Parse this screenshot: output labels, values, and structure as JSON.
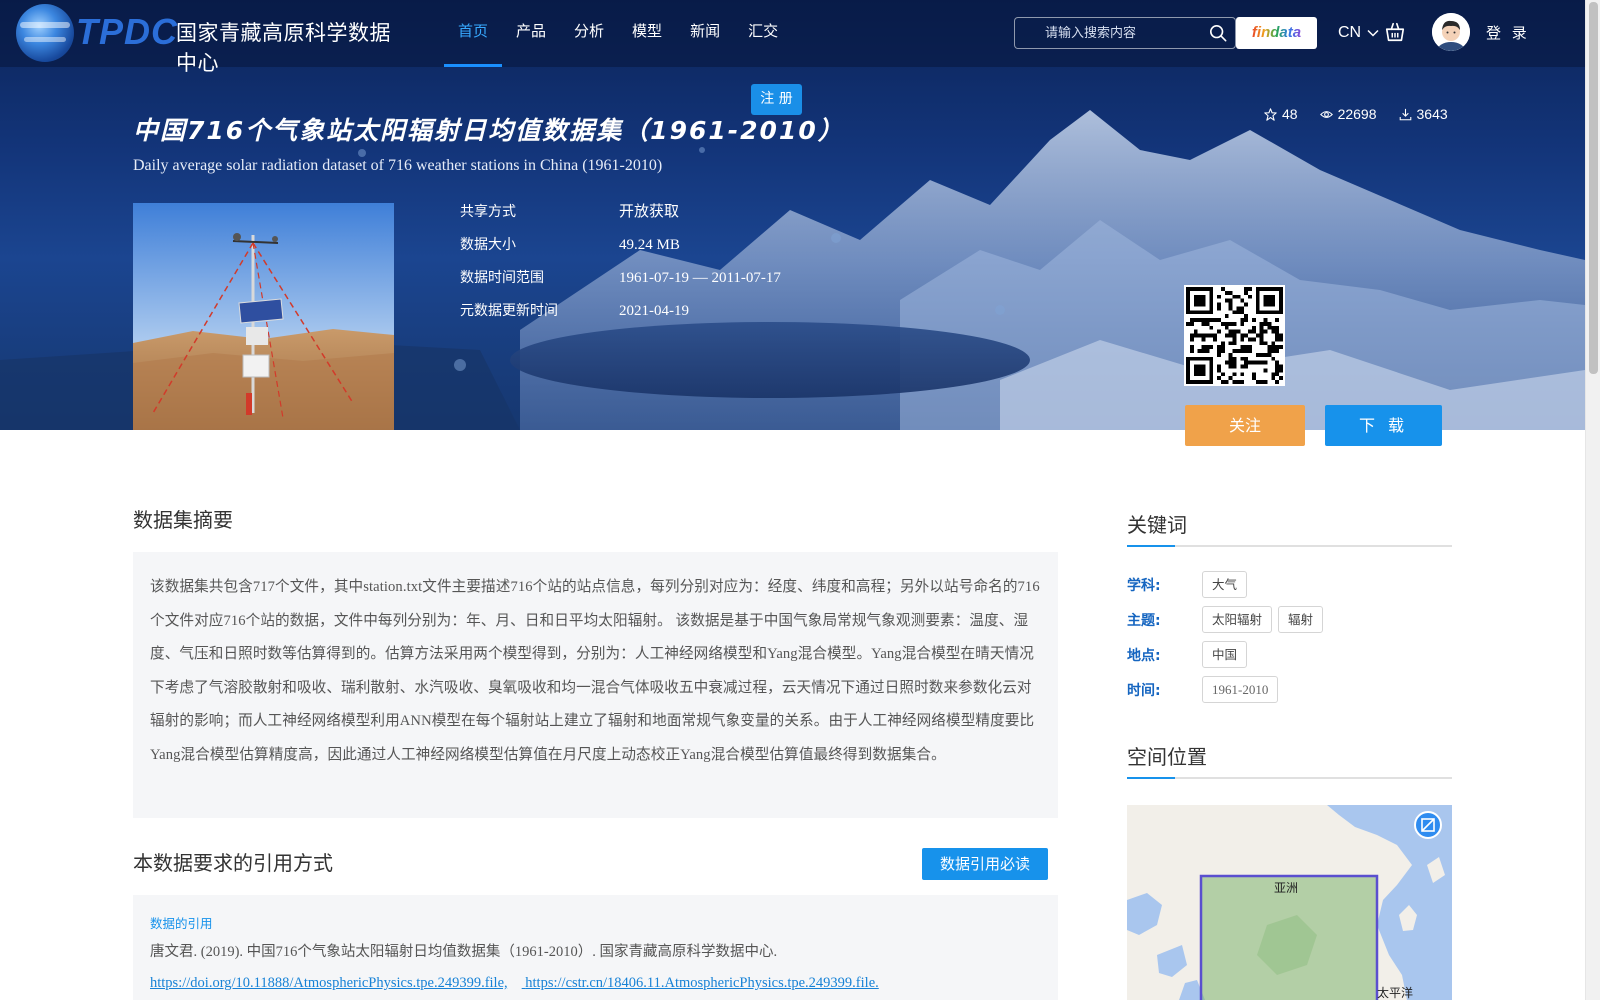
{
  "brand": {
    "abbr": "TPDC",
    "name": "国家青藏高原科学数据中心"
  },
  "nav": {
    "items": [
      {
        "label": "首页",
        "active": true
      },
      {
        "label": "产品",
        "active": false
      },
      {
        "label": "分析",
        "active": false
      },
      {
        "label": "模型",
        "active": false
      },
      {
        "label": "新闻",
        "active": false
      },
      {
        "label": "汇交",
        "active": false
      }
    ],
    "register_label": "注 册"
  },
  "header": {
    "search_placeholder": "请输入搜索内容",
    "findata_label": "findata",
    "language": "CN",
    "login_label": "登 录"
  },
  "dataset": {
    "title": "中国716个气象站太阳辐射日均值数据集（1961-2010）",
    "subtitle": "Daily average solar radiation dataset of 716 weather stations in China (1961-2010)",
    "stats": {
      "stars": "48",
      "views": "22698",
      "downloads": "3643"
    },
    "meta": [
      {
        "label": "共享方式",
        "value": "开放获取"
      },
      {
        "label": "数据大小",
        "value": "49.24 MB"
      },
      {
        "label": "数据时间范围",
        "value": "1961-07-19 — 2011-07-17"
      },
      {
        "label": "元数据更新时间",
        "value": "2021-04-19"
      }
    ],
    "follow_label": "关注",
    "download_label": "下 载"
  },
  "abstract": {
    "heading": "数据集摘要",
    "text": "该数据集共包含717个文件，其中station.txt文件主要描述716个站的站点信息，每列分别对应为：经度、纬度和高程；另外以站号命名的716个文件对应716个站的数据，文件中每列分别为：年、月、日和日平均太阳辐射。 该数据是基于中国气象局常规气象观测要素：温度、湿度、气压和日照时数等估算得到的。估算方法采用两个模型得到，分别为：人工神经网络模型和Yang混合模型。Yang混合模型在晴天情况下考虑了气溶胶散射和吸收、瑞利散射、水汽吸收、臭氧吸收和均一混合气体吸收五中衰减过程，云天情况下通过日照时数来参数化云对辐射的影响；而人工神经网络模型利用ANN模型在每个辐射站上建立了辐射和地面常规气象变量的关系。由于人工神经网络模型精度要比Yang混合模型估算精度高，因此通过人工神经网络模型估算值在月尺度上动态校正Yang混合模型估算值最终得到数据集合。"
  },
  "citation": {
    "heading": "本数据要求的引用方式",
    "must_read_label": "数据引用必读",
    "data_cite_label": "数据的引用",
    "text": "唐文君. (2019). 中国716个气象站太阳辐射日均值数据集（1961-2010）. 国家青藏高原科学数据中心.",
    "links": [
      "https://doi.org/10.11888/AtmosphericPhysics.tpe.249399.file,",
      "https://cstr.cn/18406.11.AtmosphericPhysics.tpe.249399.file."
    ]
  },
  "keywords": {
    "heading": "关键词",
    "rows": [
      {
        "label": "学科:",
        "tags": [
          "大气"
        ]
      },
      {
        "label": "主题:",
        "tags": [
          "太阳辐射",
          "辐射"
        ]
      },
      {
        "label": "地点:",
        "tags": [
          "中国"
        ]
      },
      {
        "label": "时间:",
        "tags": [
          "1961-2010"
        ]
      }
    ]
  },
  "spatial": {
    "heading": "空间位置",
    "map_labels": {
      "region": "亚洲",
      "ocean": "太平洋"
    }
  },
  "colors": {
    "accent": "#1792eb",
    "follow": "#f0a24a",
    "keyword_label": "#1565c0",
    "nav_active": "#37a9ff"
  }
}
